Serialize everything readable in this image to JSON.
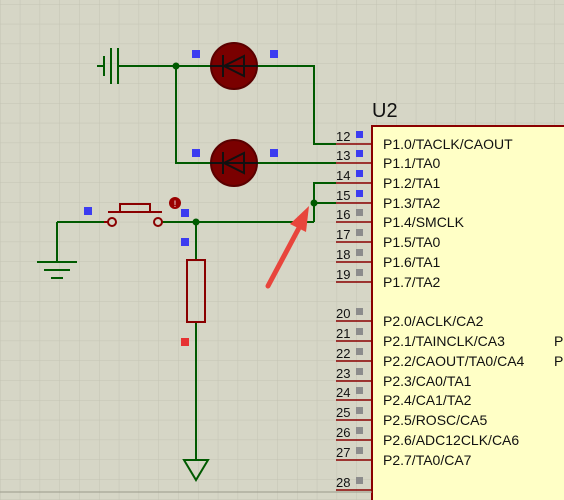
{
  "chip": {
    "ref": "U2",
    "pins": [
      {
        "num": "12",
        "label": "P1.0/TACLK/CAOUT"
      },
      {
        "num": "13",
        "label": "P1.1/TA0"
      },
      {
        "num": "14",
        "label": "P1.2/TA1"
      },
      {
        "num": "15",
        "label": "P1.3/TA2"
      },
      {
        "num": "16",
        "label": "P1.4/SMCLK"
      },
      {
        "num": "17",
        "label": "P1.5/TA0"
      },
      {
        "num": "18",
        "label": "P1.6/TA1"
      },
      {
        "num": "19",
        "label": "P1.7/TA2"
      },
      {
        "num": "20",
        "label": "P2.0/ACLK/CA2"
      },
      {
        "num": "21",
        "label": "P2.1/TAINCLK/CA3"
      },
      {
        "num": "22",
        "label": "P2.2/CAOUT/TA0/CA4"
      },
      {
        "num": "23",
        "label": "P2.3/CA0/TA1"
      },
      {
        "num": "24",
        "label": "P2.4/CA1/TA2"
      },
      {
        "num": "25",
        "label": "P2.5/ROSC/CA5"
      },
      {
        "num": "26",
        "label": "P2.6/ADC12CLK/CA6"
      },
      {
        "num": "27",
        "label": "P2.7/TA0/CA7"
      },
      {
        "num": "28",
        "label": ""
      }
    ],
    "clipped_right_labels": [
      "P",
      "P"
    ]
  },
  "colors": {
    "background": "#d6d6c6",
    "grid": "#c4c4b4",
    "wire": "#005a00",
    "component": "#8a0000",
    "chip_body": "#ffffc6",
    "pin_marker_blue": "#3c3cf0",
    "pin_marker_gray": "#8c8c8c",
    "pin_marker_red": "#e63232",
    "arrow": "#e8453c"
  },
  "icons": [
    "diode-icon",
    "push-button-icon",
    "resistor-icon",
    "ground-icon",
    "arrow-icon"
  ]
}
